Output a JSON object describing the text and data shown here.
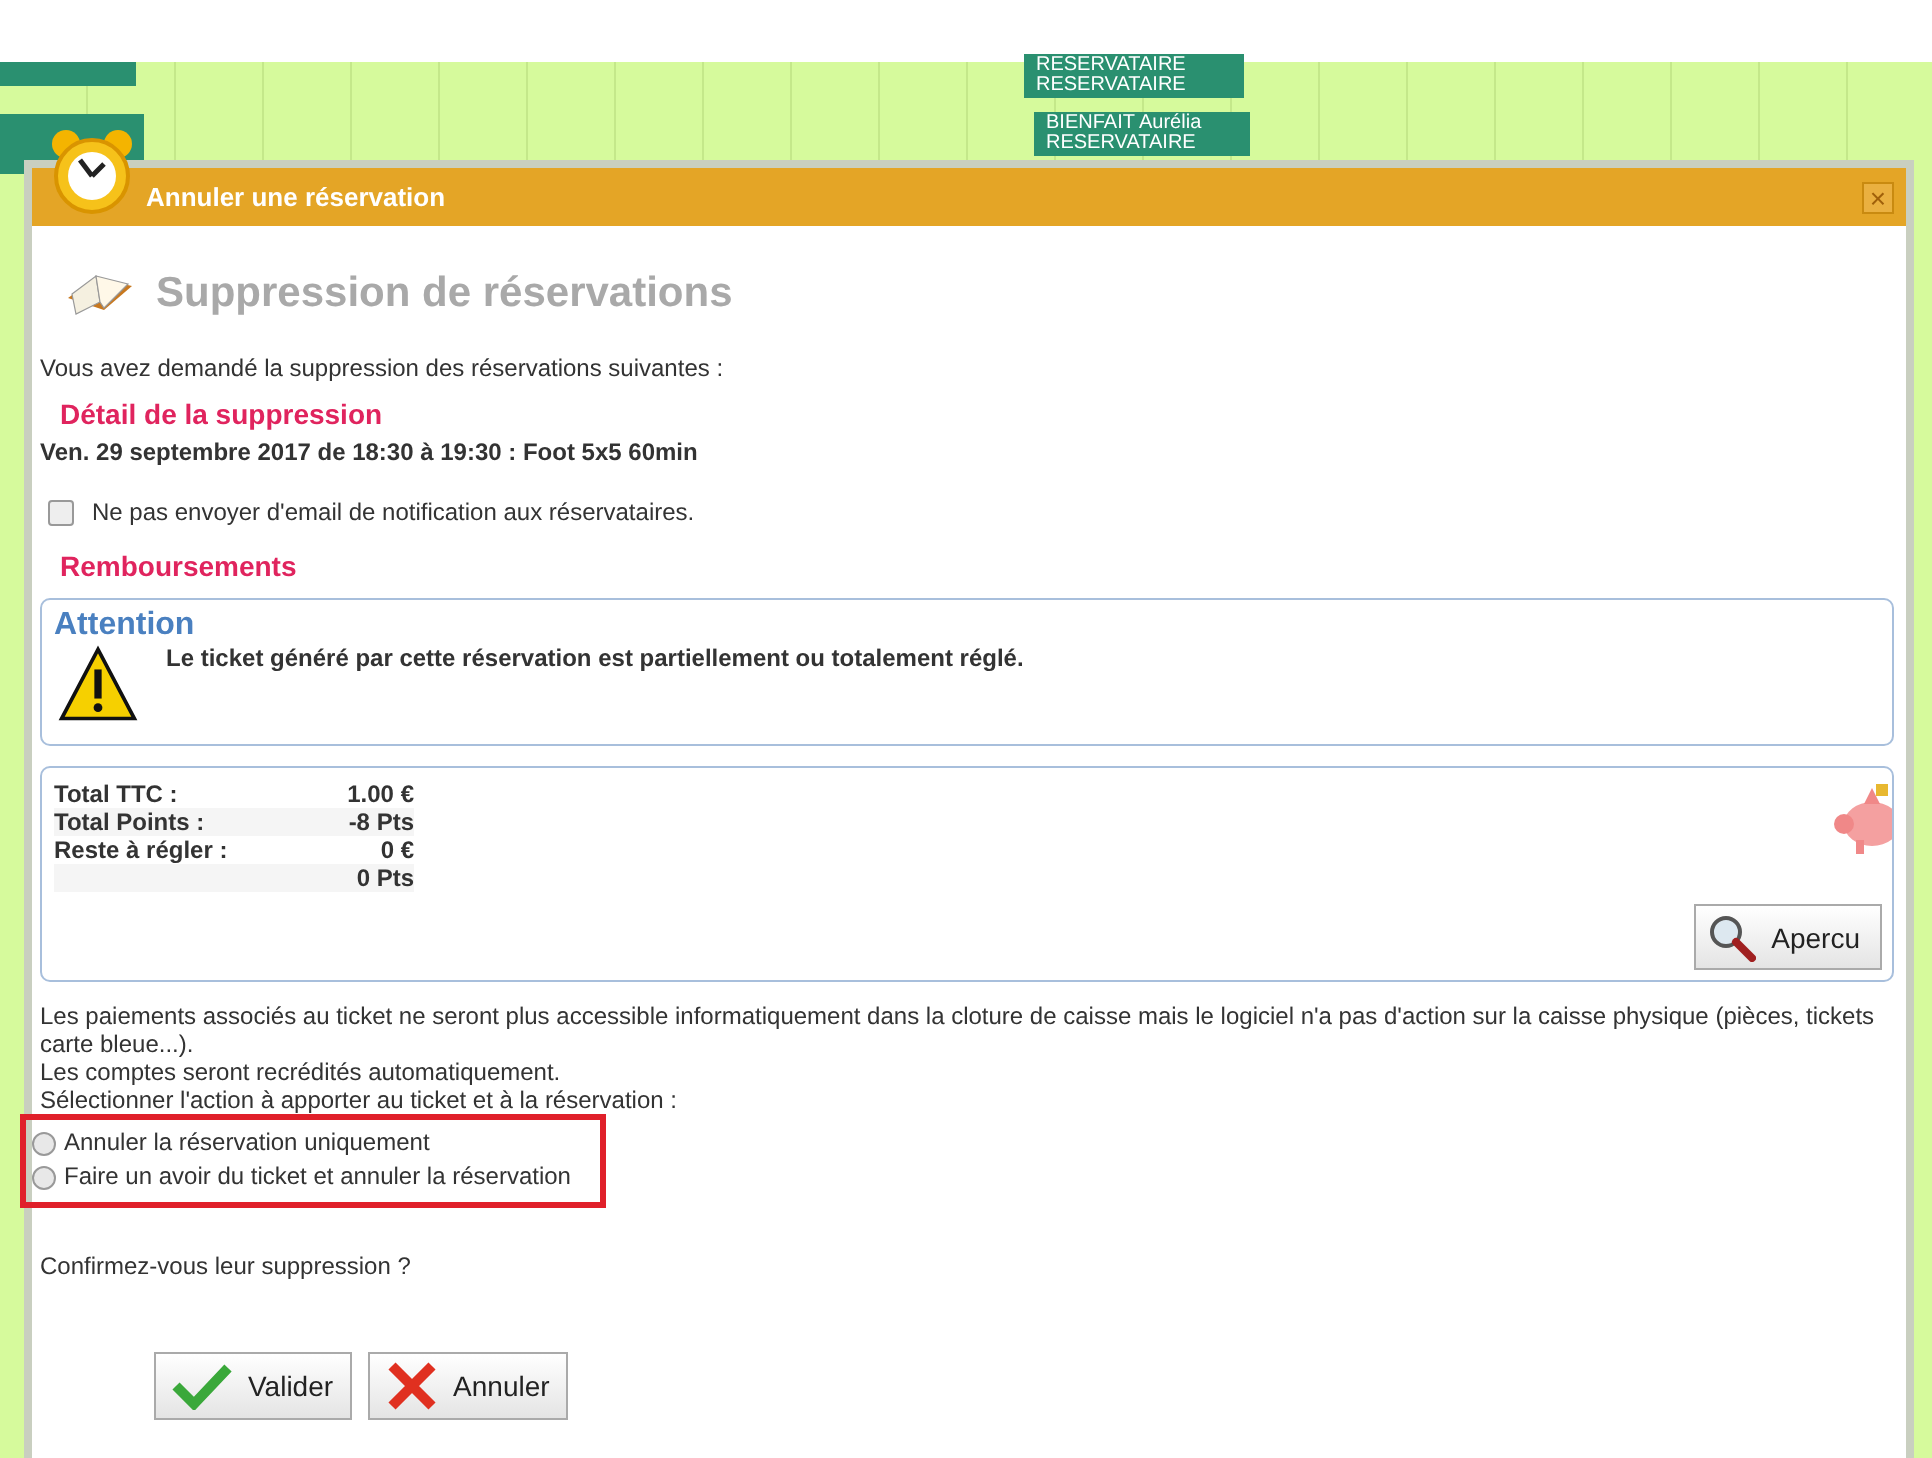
{
  "calendar": {
    "bookings": [
      {
        "lines": [
          "RESERVATAIRE",
          "RESERVATAIRE"
        ]
      },
      {
        "lines": [
          "BIENFAIT Aurélia",
          "RESERVATAIRE"
        ]
      }
    ]
  },
  "dialog": {
    "title": "Annuler une réservation",
    "close": "×",
    "heading": "Suppression de réservations",
    "intro": "Vous avez demandé la suppression des réservations suivantes :",
    "detail_title": "Détail de la suppression",
    "detail": "Ven. 29 septembre 2017 de 18:30 à 19:30 : Foot 5x5 60min",
    "no_email": {
      "label": "Ne pas envoyer d'email de notification aux réservataires.",
      "checked": false
    },
    "refunds_title": "Remboursements",
    "attention": {
      "title": "Attention",
      "message": "Le ticket généré par cette réservation est partiellement ou totalement réglé."
    },
    "totals": [
      {
        "label": "Total TTC :",
        "value": "1.00 €"
      },
      {
        "label": "Total Points :",
        "value": "-8 Pts"
      },
      {
        "label": "Reste à régler :",
        "value": "0 €"
      },
      {
        "value": "0 Pts"
      }
    ],
    "preview_button": "Apercu",
    "notes": [
      "Les paiements associés au ticket ne seront plus accessible informatiquement dans la cloture de caisse mais le logiciel n'a pas d'action sur la caisse physique (pièces, tickets carte bleue...).",
      "Les comptes seront recrédités automatiquement.",
      "Sélectionner l'action à apporter au ticket et à la réservation :"
    ],
    "options": [
      {
        "label": "Annuler la réservation uniquement",
        "selected": false
      },
      {
        "label": "Faire un avoir du ticket et annuler la réservation",
        "selected": false
      }
    ],
    "confirm": "Confirmez-vous leur suppression ?",
    "buttons": [
      {
        "kind": "ok",
        "label": "Valider"
      },
      {
        "kind": "cancel",
        "label": "Annuler"
      }
    ]
  }
}
